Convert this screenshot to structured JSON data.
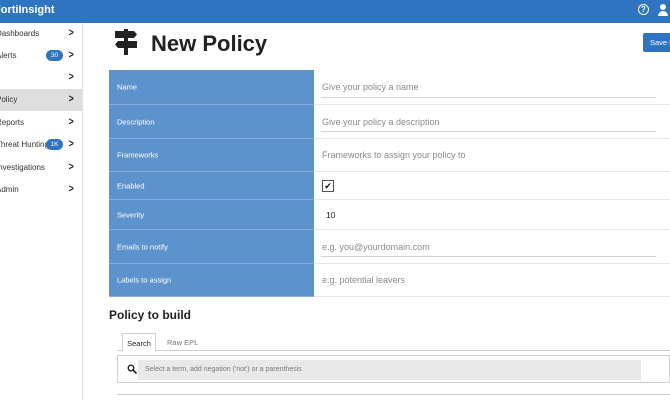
{
  "app": {
    "brand": "FortiInsight"
  },
  "topbar": {
    "help_glyph": "?"
  },
  "sidebar": {
    "items": [
      {
        "label": "Dashboards",
        "badge": "",
        "chevron": ">"
      },
      {
        "label": "Alerts",
        "badge": "30",
        "chevron": ">"
      },
      {
        "label": "",
        "badge": "",
        "chevron": ">"
      },
      {
        "label": "Policy",
        "badge": "",
        "chevron": ">",
        "active": true
      },
      {
        "label": "Reports",
        "badge": "",
        "chevron": ">"
      },
      {
        "label": "Threat Hunting",
        "badge": "1K",
        "chevron": ">"
      },
      {
        "label": "Investigations",
        "badge": "",
        "chevron": ">"
      },
      {
        "label": "Admin",
        "badge": "",
        "chevron": ">"
      }
    ]
  },
  "header": {
    "title": "New Policy",
    "save_label": "Save Policy"
  },
  "form": {
    "name": {
      "label": "Name",
      "placeholder": "Give your policy a name"
    },
    "description": {
      "label": "Description",
      "placeholder": "Give your policy a description"
    },
    "frameworks": {
      "label": "Frameworks",
      "placeholder": "Frameworks to assign your policy to"
    },
    "enabled": {
      "label": "Enabled",
      "checked": true,
      "check_glyph": "✔"
    },
    "severity": {
      "label": "Severity",
      "value": "10"
    },
    "emails": {
      "label": "Emails to notify",
      "placeholder": "e.g. you@yourdomain.com"
    },
    "labels": {
      "label": "Labels to assign",
      "placeholder": "e.g. potential leavers"
    }
  },
  "builder": {
    "title": "Policy to build",
    "tabs": [
      {
        "label": "Search",
        "active": true
      },
      {
        "label": "Raw EPL",
        "active": false
      }
    ],
    "search_placeholder": "Select a term, add negation ('not') or a parenthesis"
  },
  "colors": {
    "accent": "#2f74c0",
    "label_bg": "#5d93cc",
    "active_nav": "#dedede"
  },
  "icons": {
    "help": "help-circle-icon",
    "user": "user-icon",
    "page": "signpost-icon",
    "search": "search-icon",
    "check": "checkmark-icon",
    "chevron": "chevron-right-icon"
  }
}
